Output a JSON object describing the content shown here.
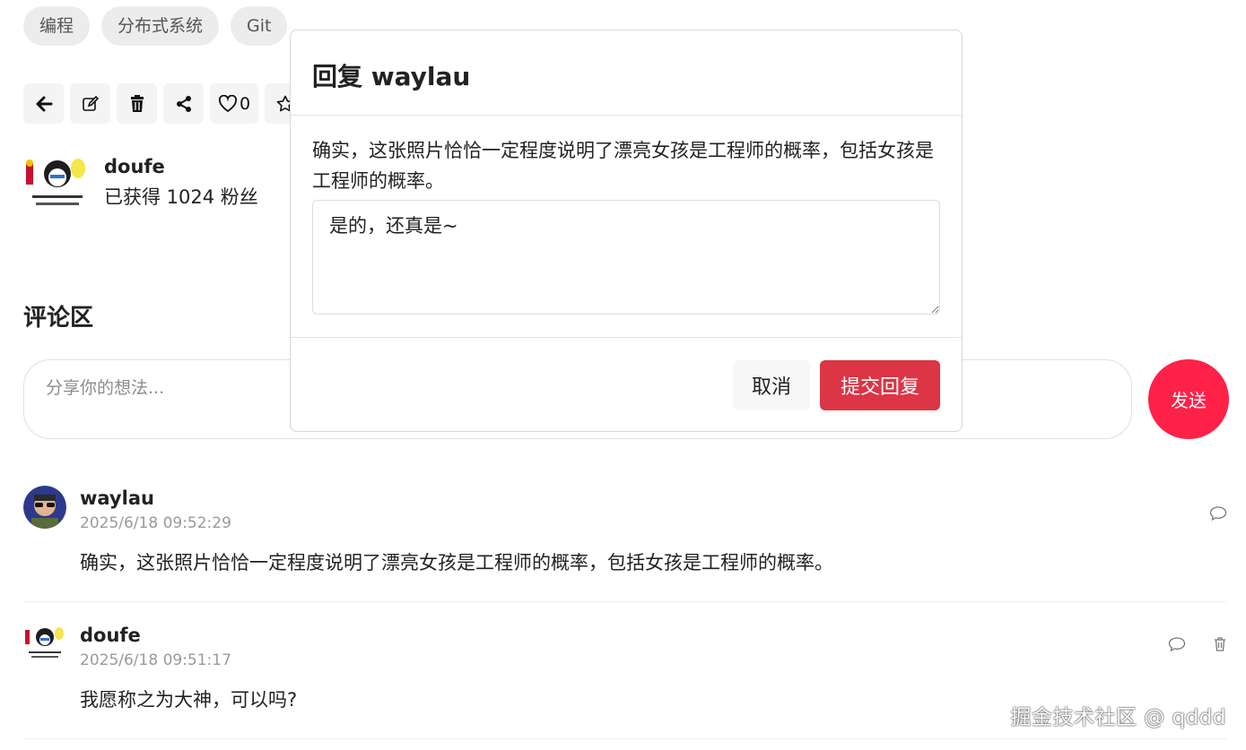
{
  "tags": [
    "编程",
    "分布式系统",
    "Git"
  ],
  "toolbar": {
    "like_count": "0"
  },
  "author": {
    "name": "doufe",
    "fans": "已获得 1024 粉丝"
  },
  "comments_section": {
    "title": "评论区",
    "input_placeholder": "分享你的想法...",
    "send_label": "发送"
  },
  "comments": [
    {
      "name": "waylau",
      "time": "2025/6/18 09:52:29",
      "text": "确实，这张照片恰恰一定程度说明了漂亮女孩是工程师的概率，包括女孩是工程师的概率。"
    },
    {
      "name": "doufe",
      "time": "2025/6/18 09:51:17",
      "text": "我愿称之为大神，可以吗?"
    }
  ],
  "modal": {
    "title": "回复 waylau",
    "quote": "确实，这张照片恰恰一定程度说明了漂亮女孩是工程师的概率，包括女孩是工程师的概率。",
    "reply_value": "是的，还真是~",
    "cancel_label": "取消",
    "submit_label": "提交回复"
  },
  "watermark": "掘金技术社区 @ qddd",
  "colors": {
    "accent_red": "#ff2147",
    "submit_red": "#dc3545"
  },
  "icons": [
    "arrow-left-icon",
    "edit-icon",
    "trash-icon",
    "share-icon",
    "heart-icon",
    "star-icon",
    "comment-icon"
  ]
}
